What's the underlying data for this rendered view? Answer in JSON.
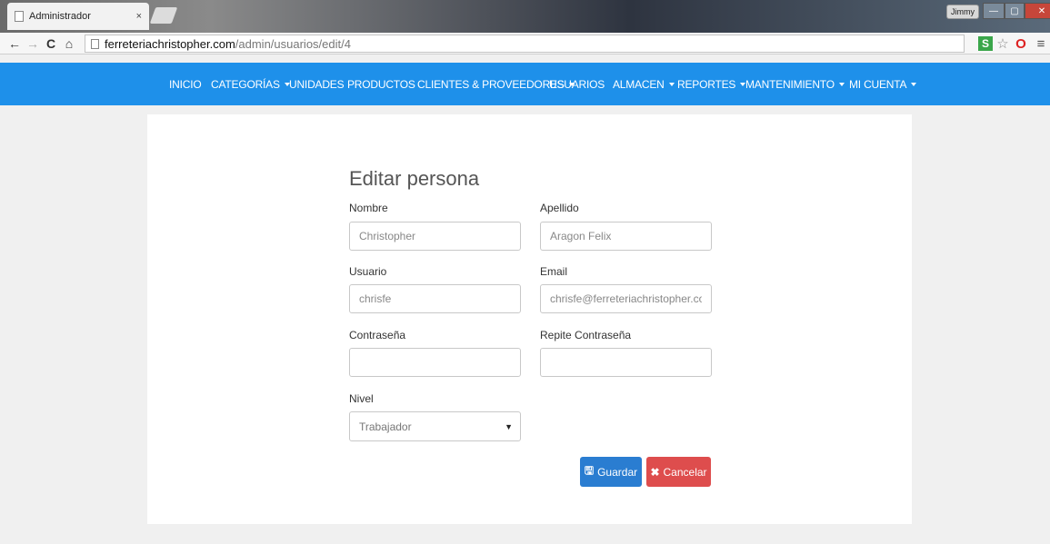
{
  "browser": {
    "tab_title": "Administrador",
    "tab_close": "×",
    "user": "Jimmy",
    "url_domain": "ferreteriachristopher.com",
    "url_path": "/admin/usuarios/edit/4",
    "ext_s": "S"
  },
  "navbar": {
    "items": [
      {
        "label": "INICIO",
        "dropdown": false
      },
      {
        "label": "CATEGORÍAS",
        "dropdown": true
      },
      {
        "label": "UNIDADES",
        "dropdown": false
      },
      {
        "label": "PRODUCTOS",
        "dropdown": false
      },
      {
        "label": "CLIENTES & PROVEEDORES",
        "dropdown": true
      },
      {
        "label": "USUARIOS",
        "dropdown": false
      },
      {
        "label": "ALMACEN",
        "dropdown": true
      },
      {
        "label": "REPORTES",
        "dropdown": true
      },
      {
        "label": "MANTENIMIENTO",
        "dropdown": true
      },
      {
        "label": "MI CUENTA",
        "dropdown": true
      }
    ],
    "color": "#1e90ea"
  },
  "form": {
    "title": "Editar persona",
    "nombre": {
      "label": "Nombre",
      "value": "Christopher"
    },
    "apellido": {
      "label": "Apellido",
      "value": "Aragon Felix"
    },
    "usuario": {
      "label": "Usuario",
      "value": "chrisfe"
    },
    "email": {
      "label": "Email",
      "value": "chrisfe@ferreteriachristopher.com"
    },
    "contrasena": {
      "label": "Contraseña",
      "value": ""
    },
    "repite": {
      "label": "Repite Contraseña",
      "value": ""
    },
    "nivel": {
      "label": "Nivel",
      "selected": "Trabajador"
    },
    "save_label": "Guardar",
    "cancel_label": "Cancelar"
  }
}
